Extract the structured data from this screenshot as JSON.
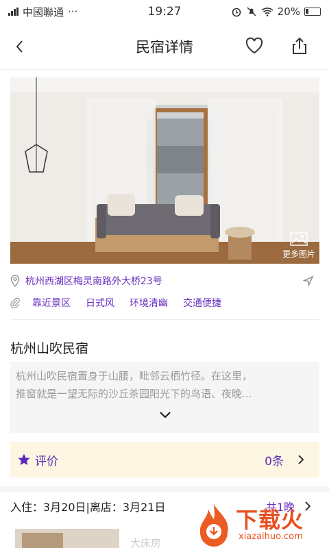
{
  "status": {
    "carrier": "中國聯通",
    "dots": "···",
    "time": "19:27",
    "battery": "20%"
  },
  "nav": {
    "title": "民宿详情"
  },
  "photo": {
    "more_label": "更多图片"
  },
  "address": "杭州西湖区梅灵南路外大桥23号",
  "tags": [
    "靠近景区",
    "日式风",
    "环境清幽",
    "交通便捷"
  ],
  "listing": {
    "title": "杭州山吹民宿",
    "description_lines": [
      "杭州山吹民宿置身于山腰，毗邻云栖竹径。在这里，",
      "推窗就是一望无际的沙丘茶园阳光下的鸟语、夜晚..."
    ]
  },
  "review": {
    "label": "评价",
    "count": "0条"
  },
  "stay": {
    "dates": "入住：3月20日|离店：3月21日",
    "nights": "共1晚"
  },
  "room": {
    "name": "大床房"
  },
  "watermark": {
    "brand": "下载火",
    "url": "xiazaihuo.com"
  },
  "colors": {
    "accent": "#6a2fc2",
    "review_bg": "#fdf6e2",
    "watermark": "#e8501f"
  }
}
